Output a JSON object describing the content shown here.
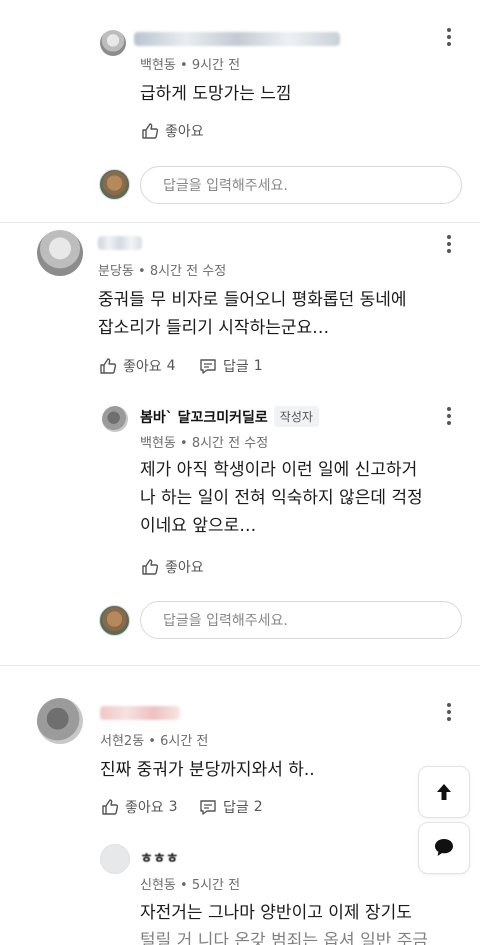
{
  "comments": [
    {
      "location": "백현동",
      "time": "9시간 전",
      "text": "급하게 도망가는 느낌",
      "like_label": "좋아요"
    },
    {
      "location": "분당동",
      "time": "8시간 전 수정",
      "text_line1": "중궈들 무 비자로 들어오니 평화롭던 동네에",
      "text_line2": "잡소리가 들리기 시작하는군요…",
      "like_label": "좋아요",
      "like_count": "4",
      "reply_label": "답글",
      "reply_count": "1"
    },
    {
      "location": "서현2동",
      "time": "6시간 전",
      "text": "진짜 중궈가 분당까지와서 하..",
      "like_label": "좋아요",
      "like_count": "3",
      "reply_label": "답글",
      "reply_count": "2"
    }
  ],
  "author_reply": {
    "nickname": "봄바ˋ 달꼬크미커딜로",
    "badge": "작성자",
    "location": "백현동",
    "time": "8시간 전 수정",
    "line1": "제가 아직 학생이라 이런 일에 신고하거",
    "line2": "나 하는 일이 전혀 익숙하지 않은데 걱정",
    "line3": "이네요 앞으로…",
    "like_label": "좋아요"
  },
  "sub_reply": {
    "nickname": "ㅎㅎㅎ",
    "location": "신현동",
    "time": "5시간 전",
    "line1": "자전거는 그나마 양반이고 이제 장기도",
    "line2": "털릴 거 니다 온갖 범죄는 옵셔 일반 주금"
  },
  "reply_input": {
    "placeholder": "답글을 입력해주세요."
  },
  "icons": {
    "more": "more-vertical-icon",
    "like": "thumbs-up-icon",
    "reply": "reply-icon",
    "scroll_top": "arrow-up-icon",
    "chat": "chat-bubble-icon"
  }
}
